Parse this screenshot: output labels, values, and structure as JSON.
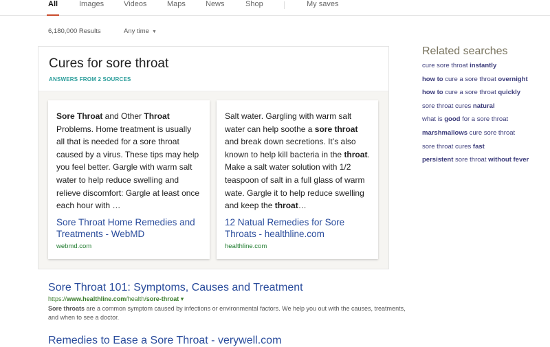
{
  "tabs": [
    {
      "label": "All",
      "active": true
    },
    {
      "label": "Images"
    },
    {
      "label": "Videos"
    },
    {
      "label": "Maps"
    },
    {
      "label": "News"
    },
    {
      "label": "Shop"
    },
    {
      "label": "My saves"
    }
  ],
  "results_count": "6,180,000 Results",
  "time_filter": "Any time",
  "answer_card": {
    "title": "Cures for sore throat",
    "subtitle": "ANSWERS FROM 2 SOURCES",
    "sources": [
      {
        "text": [
          {
            "b": true,
            "t": "Sore Throat"
          },
          {
            "t": " and Other "
          },
          {
            "b": true,
            "t": "Throat"
          },
          {
            "t": " Problems. Home treatment is usually all that is needed for a sore throat caused by a virus. These tips may help you feel better. Gargle with warm salt water to help reduce swelling and relieve discomfort: Gargle at least once each hour with …"
          }
        ],
        "link": "Sore Throat Home Remedies and Treatments - WebMD",
        "domain": "webmd.com"
      },
      {
        "text": [
          {
            "t": "Salt water. Gargling with warm salt water can help soothe a "
          },
          {
            "b": true,
            "t": "sore throat"
          },
          {
            "t": " and break down secretions. It’s also known to help kill bacteria in the "
          },
          {
            "b": true,
            "t": "throat"
          },
          {
            "t": ". Make a salt water solution with 1/2 teaspoon of salt in a full glass of warm wate. Gargle it to help reduce swelling and keep the "
          },
          {
            "b": true,
            "t": "throat"
          },
          {
            "t": "…"
          }
        ],
        "link": "12 Natual Remedies for Sore Throats - healthline.com",
        "domain": "healthline.com"
      }
    ]
  },
  "results": [
    {
      "title": "Sore Throat 101: Symptoms, Causes and Treatment",
      "url": [
        {
          "t": "https://"
        },
        {
          "b": true,
          "t": "www.healthline.com"
        },
        {
          "t": "/health/"
        },
        {
          "b": true,
          "t": "sore-throat"
        },
        {
          "t": " ▾"
        }
      ],
      "snippet": [
        {
          "b": true,
          "t": "Sore throats"
        },
        {
          "t": " are a common symptom caused by infections or environmental factors. We help you out with the causes, treatments, and when to see a doctor."
        }
      ]
    },
    {
      "title": "Remedies to Ease a Sore Throat - verywell.com"
    }
  ],
  "related": {
    "heading": "Related searches",
    "items": [
      [
        {
          "t": "cure sore throat "
        },
        {
          "b": true,
          "t": "instantly"
        }
      ],
      [
        {
          "b": true,
          "t": "how to"
        },
        {
          "t": " cure a sore throat "
        },
        {
          "b": true,
          "t": "overnight"
        }
      ],
      [
        {
          "b": true,
          "t": "how to"
        },
        {
          "t": " cure a sore throat "
        },
        {
          "b": true,
          "t": "quickly"
        }
      ],
      [
        {
          "t": "sore throat cures "
        },
        {
          "b": true,
          "t": "natural"
        }
      ],
      [
        {
          "t": "what is "
        },
        {
          "b": true,
          "t": "good"
        },
        {
          "t": " for a sore throat"
        }
      ],
      [
        {
          "b": true,
          "t": "marshmallows"
        },
        {
          "t": " cure sore throat"
        }
      ],
      [
        {
          "t": "sore throat cures "
        },
        {
          "b": true,
          "t": "fast"
        }
      ],
      [
        {
          "b": true,
          "t": "persistent"
        },
        {
          "t": " sore throat "
        },
        {
          "b": true,
          "t": "without fever"
        }
      ]
    ]
  }
}
